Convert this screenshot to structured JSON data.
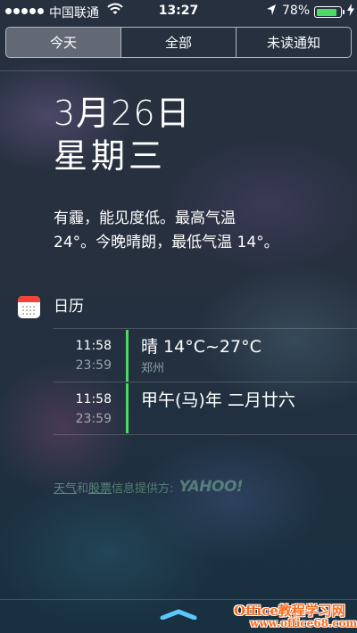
{
  "status_bar": {
    "carrier": "中国联通",
    "time": "13:27",
    "battery_percent": "78%",
    "battery_level": 0.78,
    "battery_color": "#4cd964"
  },
  "tabs": [
    {
      "label": "今天",
      "selected": true
    },
    {
      "label": "全部",
      "selected": false
    },
    {
      "label": "未读通知",
      "selected": false
    }
  ],
  "today": {
    "date": "3月26日",
    "weekday": "星期三",
    "weather_summary_line1": "有霾，能见度低。最高气温",
    "weather_summary_line2": "24°。今晚晴朗，最低气温 14°。"
  },
  "calendar": {
    "title": "日历",
    "icon": "calendar-app-icon",
    "accent_color": "#4cd964",
    "events": [
      {
        "start": "11:58",
        "end": "23:59",
        "title": "晴 14°C~27°C",
        "location": "郑州"
      },
      {
        "start": "11:58",
        "end": "23:59",
        "title": "甲午(马)年 二月廿六",
        "location": ""
      }
    ]
  },
  "attribution": {
    "weather_link": "天气",
    "and": "和",
    "stocks_link": "股票",
    "provided_by": "信息提供方:",
    "provider_logo": "YAHOO!"
  },
  "grabber_icon": "chevron-up-grabber-icon",
  "watermark": {
    "line1": "Office教程学习网",
    "line2": "www.office68.com"
  }
}
